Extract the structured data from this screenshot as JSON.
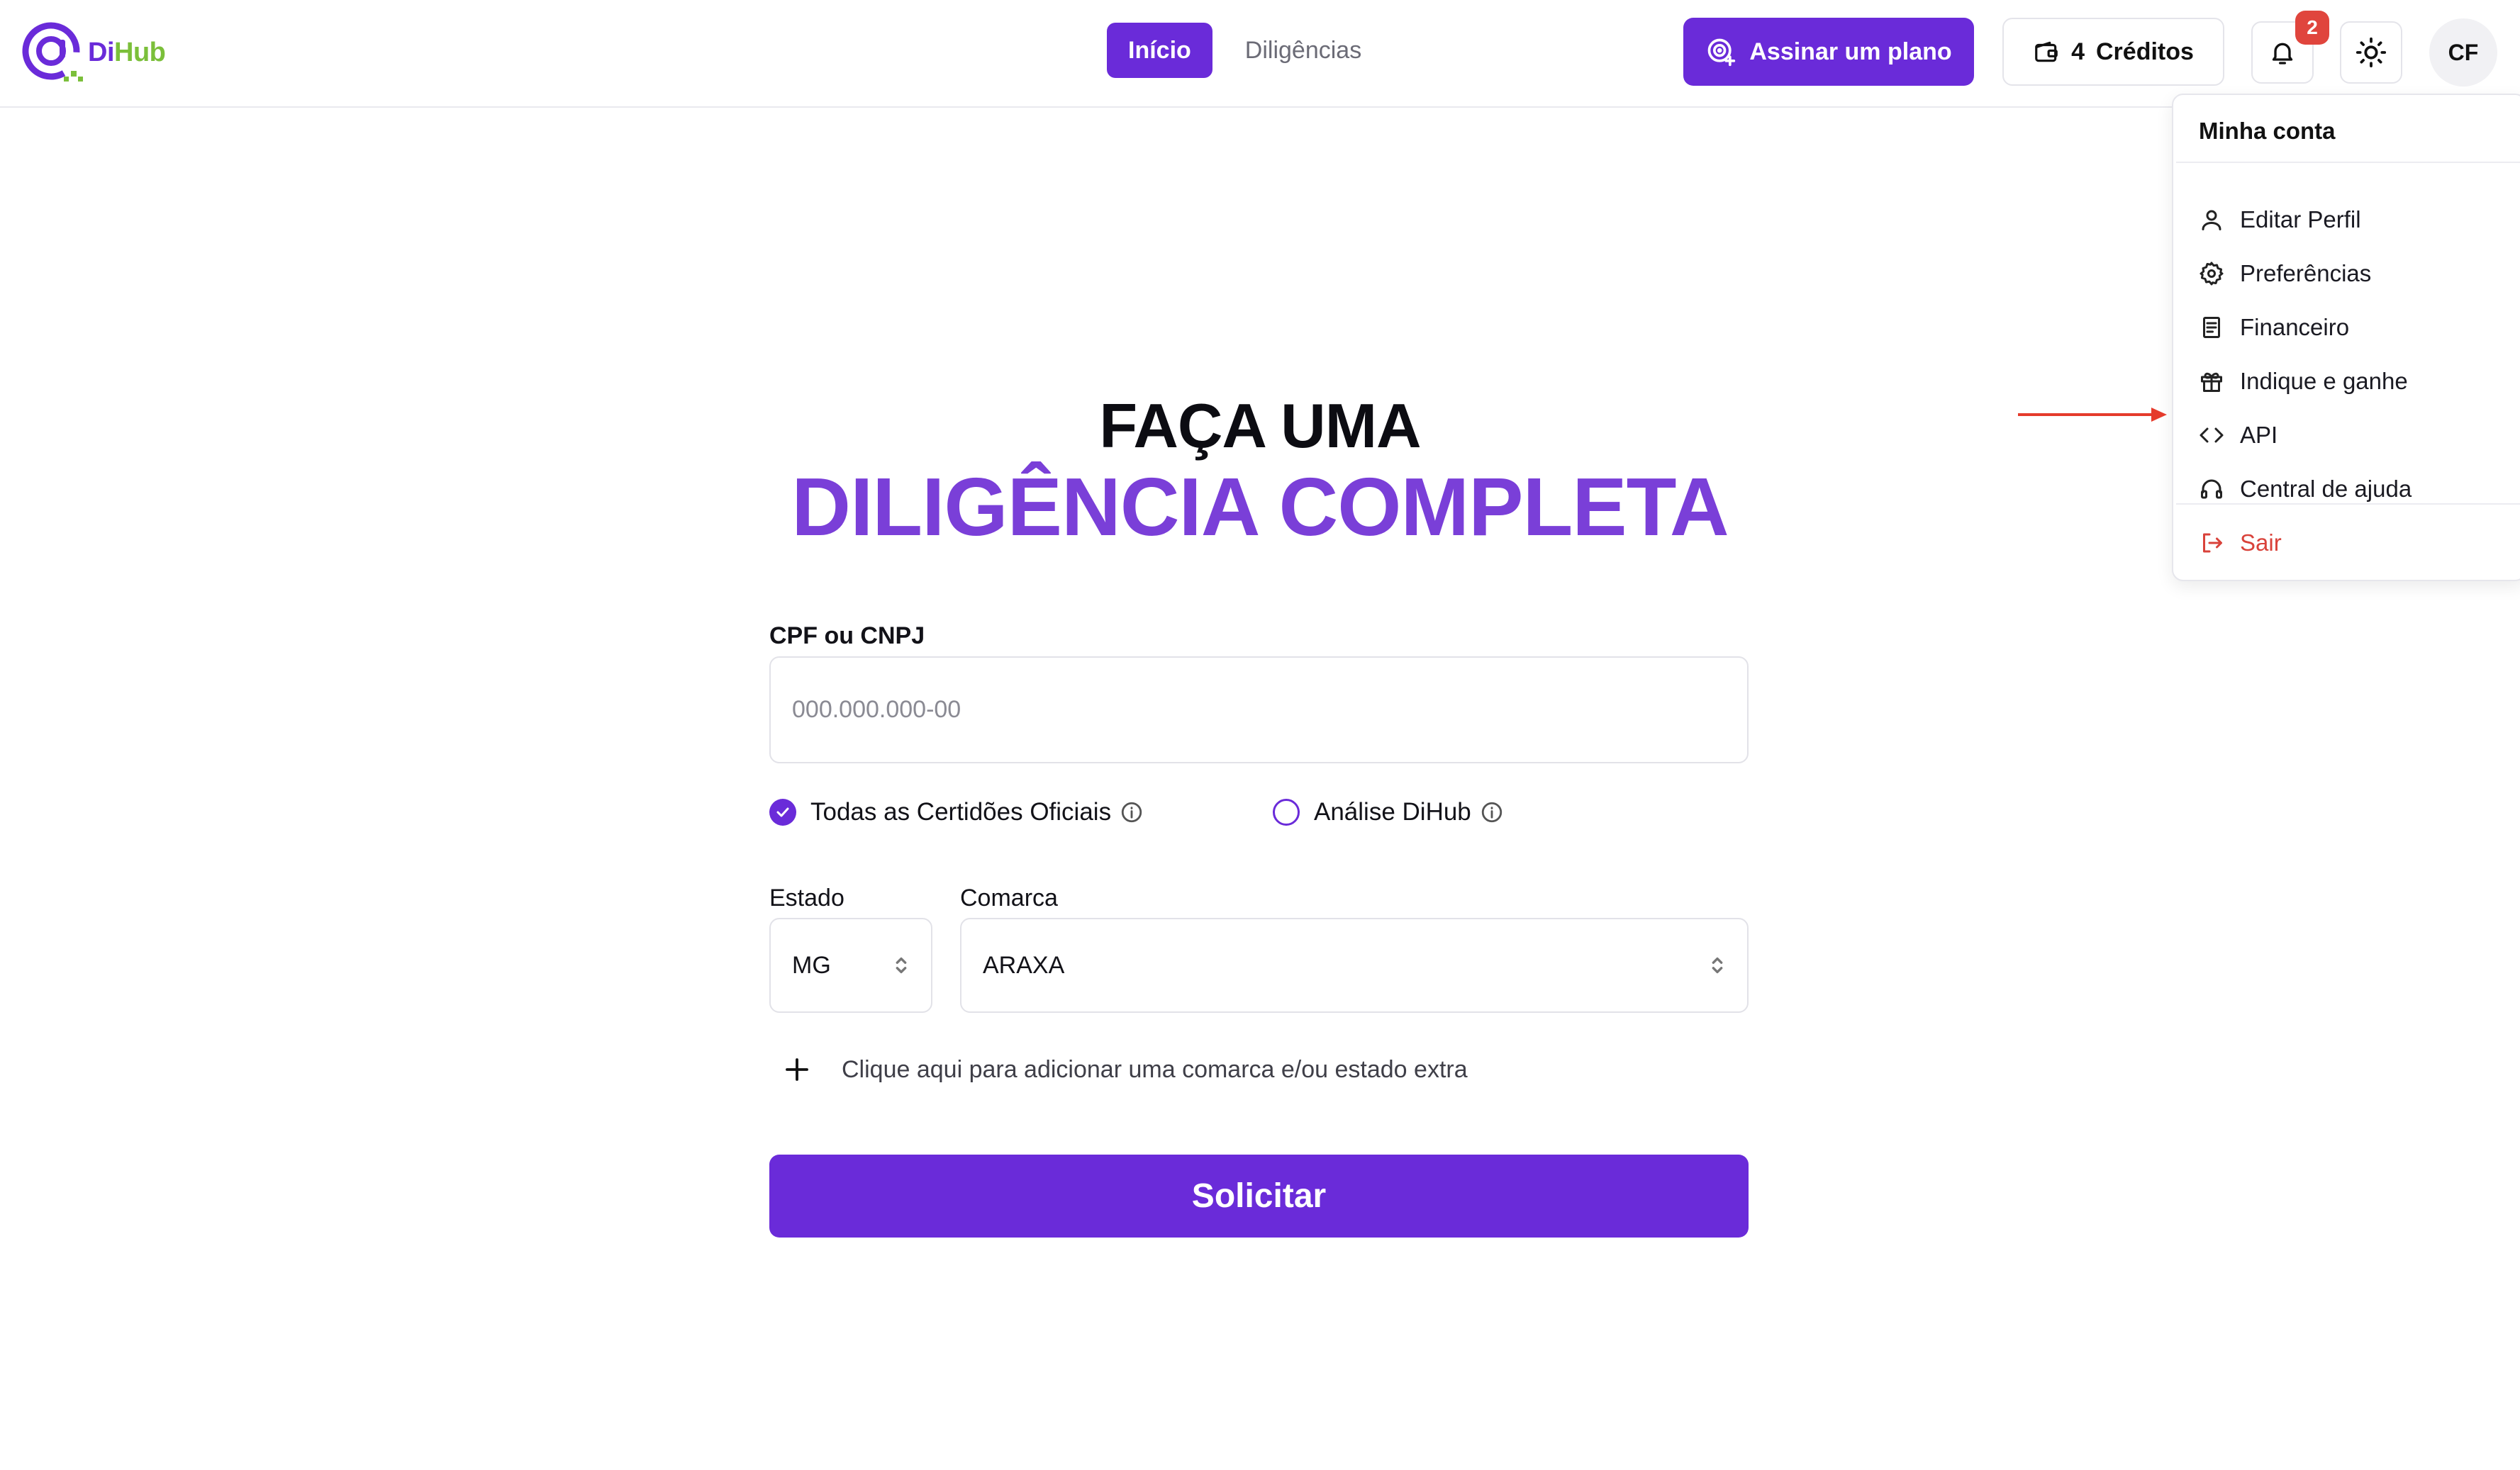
{
  "brand": {
    "name_part1": "Di",
    "name_part2": "Hub",
    "primary_color": "#6a2bd9",
    "accent_color": "#7bbf3a"
  },
  "nav": {
    "tabs": [
      {
        "label": "Início",
        "active": true
      },
      {
        "label": "Diligências",
        "active": false
      }
    ]
  },
  "header": {
    "plan_button_label": "Assinar um plano",
    "credits_count": "4",
    "credits_label": "Créditos",
    "notifications_count": "2",
    "avatar_initials": "CF"
  },
  "account_menu": {
    "title": "Minha conta",
    "items": [
      {
        "label": "Editar Perfil",
        "icon": "user-icon"
      },
      {
        "label": "Preferências",
        "icon": "gear-icon"
      },
      {
        "label": "Financeiro",
        "icon": "receipt-icon"
      },
      {
        "label": "Indique e ganhe",
        "icon": "gift-icon"
      },
      {
        "label": "API",
        "icon": "code-icon"
      },
      {
        "label": "Central de ajuda",
        "icon": "headset-icon"
      }
    ],
    "logout_label": "Sair",
    "logout_color": "#d9423a"
  },
  "hero": {
    "line1": "FAÇA UMA",
    "line2": "DILIGÊNCIA COMPLETA",
    "line2_color": "#7a3fd8"
  },
  "form": {
    "document_label": "CPF ou CNPJ",
    "document_placeholder": "000.000.000-00",
    "option_official": {
      "label": "Todas as Certidões Oficiais",
      "checked": true
    },
    "option_analysis": {
      "label": "Análise DiHub",
      "checked": false
    },
    "state_label": "Estado",
    "state_value": "MG",
    "district_label": "Comarca",
    "district_value": "ARAXA",
    "add_extra_label": "Clique aqui para adicionar uma comarca e/ou estado extra",
    "submit_label": "Solicitar"
  },
  "annotation": {
    "arrow_color": "#e53b2c"
  }
}
